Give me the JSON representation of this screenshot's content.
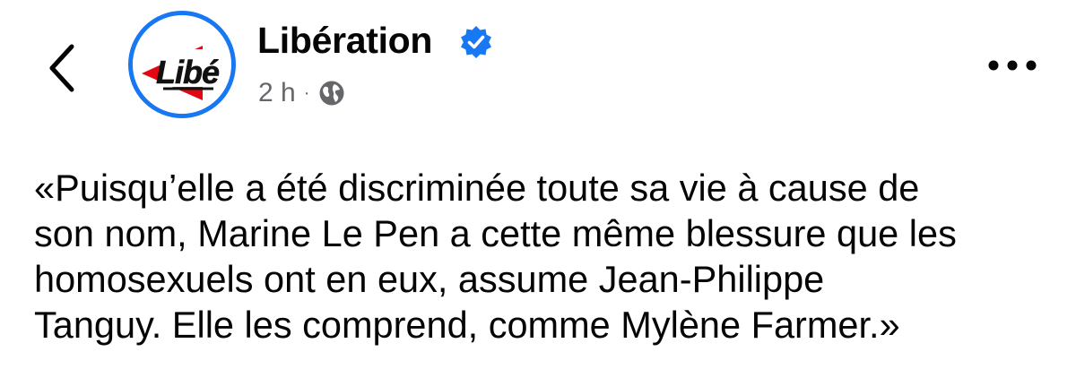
{
  "header": {
    "page_name": "Libération",
    "verified": true,
    "timestamp": "2 h",
    "separator": "·",
    "audience_icon": "globe-icon",
    "back_icon": "chevron-left-icon",
    "more_icon": "more-horizontal-icon"
  },
  "avatar": {
    "logo_text": "Libé",
    "border_color": "#1877f2",
    "logo_red": "#e30613"
  },
  "post": {
    "lines": [
      "«Puisqu’elle a été discriminée toute sa vie à cause de",
      "son nom, Marine Le Pen a cette même blessure que les",
      "homosexuels ont en eux, assume Jean-Philippe",
      "Tanguy. Elle les comprend, comme Mylène Farmer.»"
    ]
  },
  "colors": {
    "text": "#050505",
    "secondary_text": "#65676b",
    "verified_blue": "#1877f2"
  }
}
